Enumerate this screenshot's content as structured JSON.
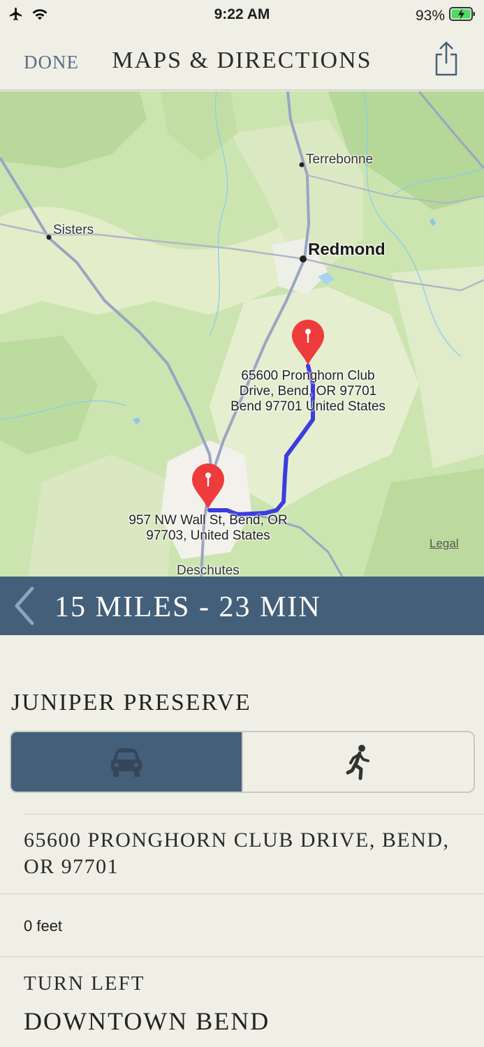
{
  "status_bar": {
    "time": "9:22 AM",
    "battery_percent": "93%"
  },
  "nav": {
    "done_label": "DONE",
    "title": "MAPS & DIRECTIONS"
  },
  "map": {
    "places": {
      "terrebonne": "Terrebonne",
      "sisters": "Sisters",
      "redmond": "Redmond",
      "deschutes": "Deschutes"
    },
    "pins": {
      "destination_line1": "65600 Pronghorn Club",
      "destination_line2": "Drive, Bend, OR 97701",
      "destination_line3": "Bend 97701 United States",
      "origin_line1": "957 NW Wall St, Bend, OR",
      "origin_line2": "97703, United States"
    },
    "legal_label": "Legal",
    "route_color": "#3c3ce0",
    "pin_color": "#ee3b3b"
  },
  "route": {
    "summary": "15 MILES - 23 MIN"
  },
  "destination": {
    "name": "JUNIPER PRESERVE",
    "modes": {
      "selected": "car"
    }
  },
  "directions": {
    "address": "65600 PRONGHORN CLUB DRIVE, BEND, OR 97701",
    "distance": "0 feet",
    "instruction": "TURN LEFT",
    "road": "DOWNTOWN BEND"
  },
  "colors": {
    "background": "#f0efe6",
    "accent": "#445f79",
    "done": "#586e86"
  }
}
